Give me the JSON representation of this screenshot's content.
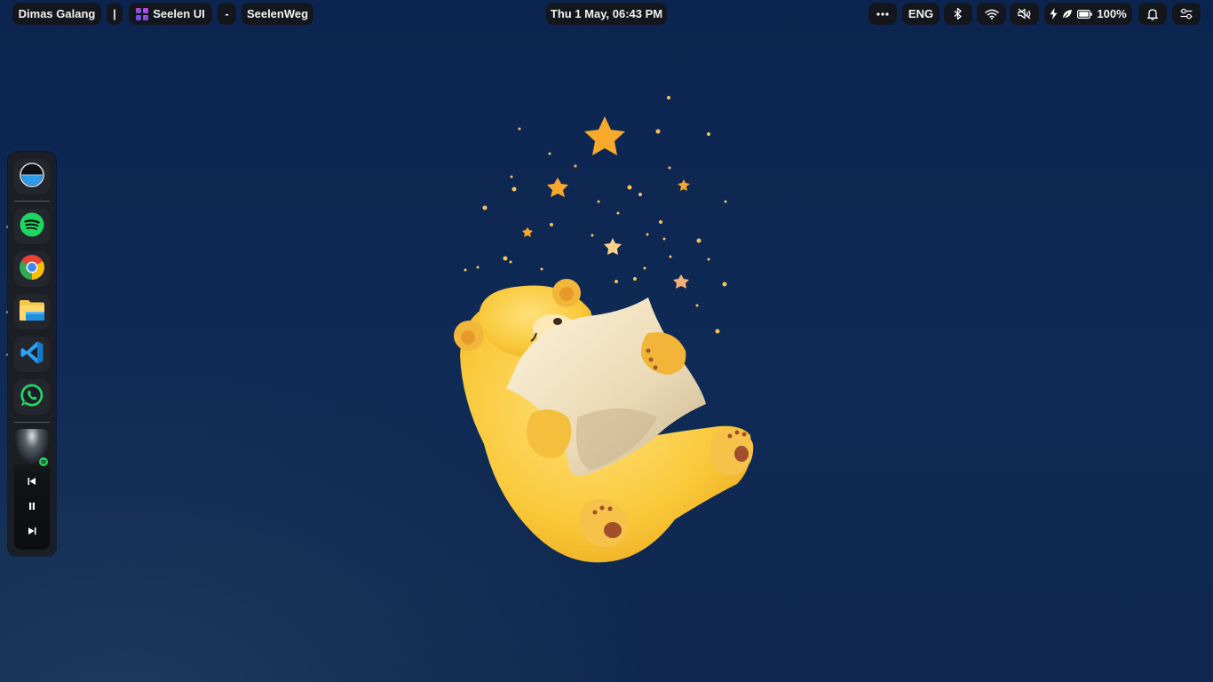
{
  "topbar": {
    "user_name": "Dimas Galang",
    "separator": "|",
    "app_name": "Seelen UI",
    "dash": "-",
    "window_title": "SeelenWeg",
    "datetime": "Thu 1 May, 06:43 PM",
    "language": "ENG",
    "battery_percent": "100%"
  },
  "icons": {
    "app_logo": "seelen-ui-logo",
    "more": "ellipsis-icon",
    "bluetooth": "bluetooth-icon",
    "wifi": "wifi-icon",
    "volume": "volume-muted-icon",
    "charging": "charging-bolt-icon",
    "power_mode": "leaf-icon",
    "battery": "battery-icon",
    "notifications": "bell-icon",
    "settings": "sliders-icon"
  },
  "dock": {
    "items": [
      {
        "name": "Seelen launcher",
        "icon": "launcher-icon"
      },
      {
        "name": "Spotify",
        "icon": "spotify-icon",
        "accent": "#1ed760"
      },
      {
        "name": "Google Chrome",
        "icon": "chrome-icon"
      },
      {
        "name": "File Explorer",
        "icon": "file-explorer-icon",
        "accent": "#f7c846"
      },
      {
        "name": "Visual Studio Code",
        "icon": "vscode-icon",
        "accent": "#2aa1f2"
      },
      {
        "name": "WhatsApp",
        "icon": "whatsapp-icon",
        "accent": "#25d366"
      }
    ],
    "media": {
      "source": "spotify-icon",
      "controls": [
        "previous-icon",
        "pause-icon",
        "next-icon"
      ]
    }
  },
  "colors": {
    "desktop_background": "#0f2a55",
    "bar_pill": "#13161d",
    "dock_background": "#1b1e24"
  }
}
